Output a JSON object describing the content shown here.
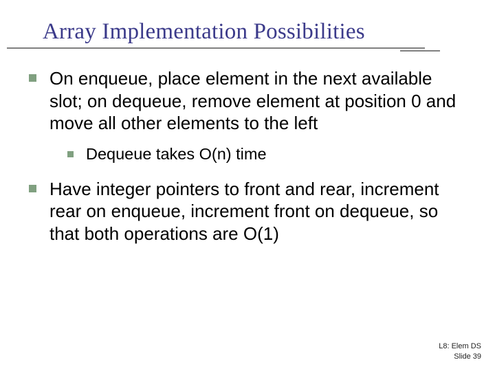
{
  "title": "Array Implementation Possibilities",
  "bullets": {
    "b1": "On enqueue, place element in the next available slot; on dequeue, remove element at position 0 and move all other elements to the left",
    "b1_sub": "Dequeue takes O(n) time",
    "b2": "Have integer pointers to front and rear, increment rear on enqueue, increment front on dequeue, so that both operations are O(1)"
  },
  "footer": {
    "line1": "L8: Elem DS",
    "line2": "Slide 39"
  },
  "colors": {
    "title": "#3b3a8a",
    "bullet_square": "#80a080"
  }
}
